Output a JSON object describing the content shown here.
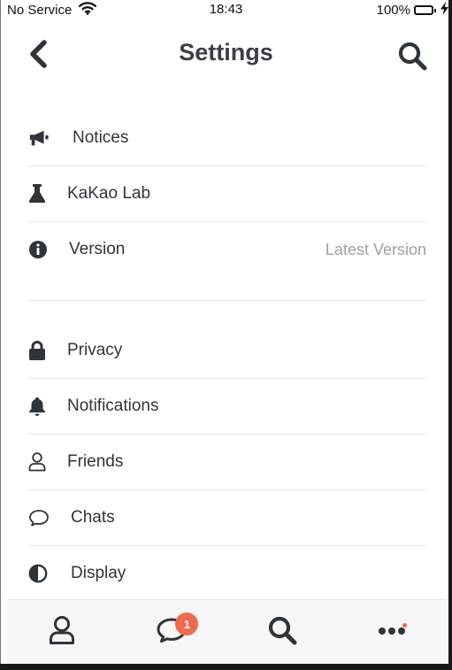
{
  "status_bar": {
    "carrier": "No Service",
    "time": "18:43",
    "battery": "100%",
    "battery_level": 1.0
  },
  "header": {
    "title": "Settings",
    "back_icon": "chevron-left-icon",
    "search_icon": "search-icon"
  },
  "sections": [
    {
      "items": [
        {
          "label": "Notices",
          "icon": "megaphone-icon"
        },
        {
          "label": "KaKao Lab",
          "icon": "flask-icon"
        },
        {
          "label": "Version",
          "icon": "info-icon",
          "value": "Latest Version"
        }
      ]
    },
    {
      "items": [
        {
          "label": "Privacy",
          "icon": "lock-icon"
        },
        {
          "label": "Notifications",
          "icon": "bell-icon"
        },
        {
          "label": "Friends",
          "icon": "user-icon"
        },
        {
          "label": "Chats",
          "icon": "chat-bubble-icon"
        },
        {
          "label": "Display",
          "icon": "contrast-icon"
        }
      ]
    }
  ],
  "tabbar": {
    "tabs": [
      {
        "icon": "user-icon"
      },
      {
        "icon": "chat-bubble-icon",
        "badge": "1"
      },
      {
        "icon": "search-icon"
      },
      {
        "icon": "more-icon",
        "has_dot": true
      }
    ]
  },
  "colors": {
    "text": "#2f343b",
    "muted": "#9aa0a6",
    "accent": "#ef6a4e",
    "divider": "#e6e6e6",
    "tabbar_bg": "#f6f6f6"
  }
}
